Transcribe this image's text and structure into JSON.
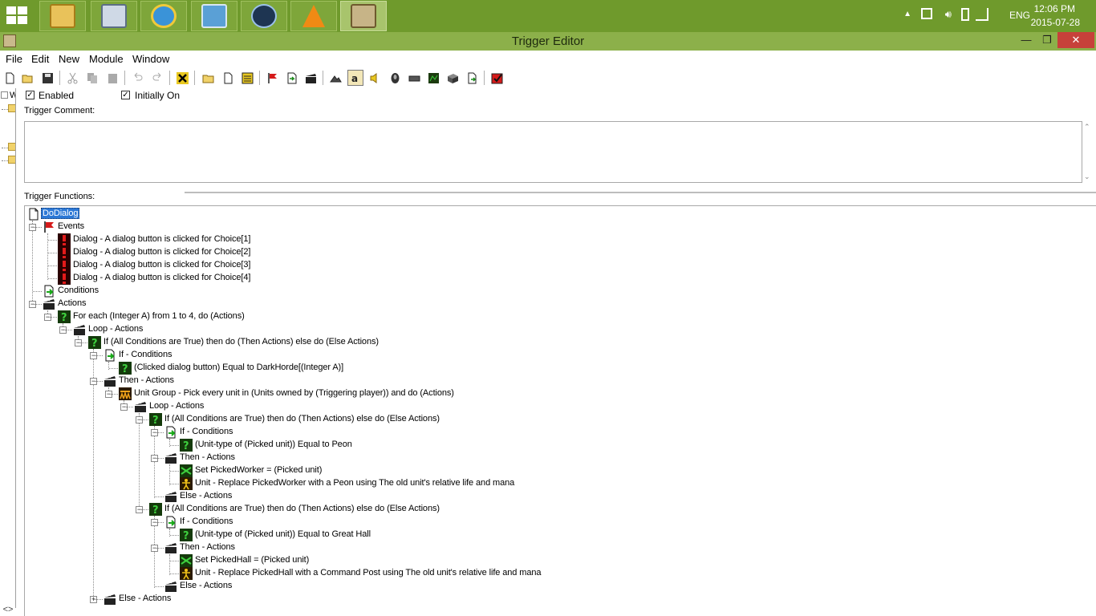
{
  "taskbar": {
    "apps": [
      "file-explorer",
      "system-monitor",
      "internet-explorer",
      "control-panel",
      "warcraft-launcher",
      "vlc",
      "world-editor"
    ],
    "tray": {
      "language": "ENG",
      "time": "12:06 PM",
      "date": "2015-07-28"
    }
  },
  "window": {
    "title": "Trigger Editor",
    "minimize": "—",
    "restore": "❐",
    "close": "✕"
  },
  "menu": [
    "File",
    "Edit",
    "New",
    "Module",
    "Window"
  ],
  "left_tree": {
    "label": "W"
  },
  "trigger": {
    "enabled_label": "Enabled",
    "enabled": true,
    "initially_on_label": "Initially On",
    "initially_on": true,
    "comment_label": "Trigger Comment:",
    "comment_value": "",
    "functions_label": "Trigger Functions:"
  },
  "tree": [
    {
      "id": "n0",
      "text": "DoDialog",
      "icon": "trigger-page",
      "selected": true
    },
    {
      "id": "n1",
      "text": "Events",
      "icon": "events-flag"
    },
    {
      "id": "n2",
      "text": "Dialog - A dialog button is clicked for Choice[1]",
      "icon": "event-alert"
    },
    {
      "id": "n3",
      "text": "Dialog - A dialog button is clicked for Choice[2]",
      "icon": "event-alert"
    },
    {
      "id": "n4",
      "text": "Dialog - A dialog button is clicked for Choice[3]",
      "icon": "event-alert"
    },
    {
      "id": "n5",
      "text": "Dialog - A dialog button is clicked for Choice[4]",
      "icon": "event-alert"
    },
    {
      "id": "n6",
      "text": "Conditions",
      "icon": "conditions"
    },
    {
      "id": "n7",
      "text": "Actions",
      "icon": "actions-clapper"
    },
    {
      "id": "n8",
      "text": "For each (Integer A) from 1 to 4, do (Actions)",
      "icon": "question-green"
    },
    {
      "id": "n9",
      "text": "Loop - Actions",
      "icon": "actions-clapper"
    },
    {
      "id": "n10",
      "text": "If (All Conditions are True) then do (Then Actions) else do (Else Actions)",
      "icon": "question-green"
    },
    {
      "id": "n11",
      "text": "If - Conditions",
      "icon": "conditions"
    },
    {
      "id": "n12",
      "text": "(Clicked dialog button) Equal to DarkHorde[(Integer A)]",
      "icon": "question-green"
    },
    {
      "id": "n13",
      "text": "Then - Actions",
      "icon": "actions-clapper"
    },
    {
      "id": "n14",
      "text": "Unit Group - Pick every unit in (Units owned by (Triggering player)) and do (Actions)",
      "icon": "unit-group"
    },
    {
      "id": "n15",
      "text": "Loop - Actions",
      "icon": "actions-clapper"
    },
    {
      "id": "n16",
      "text": "If (All Conditions are True) then do (Then Actions) else do (Else Actions)",
      "icon": "question-green"
    },
    {
      "id": "n17",
      "text": "If - Conditions",
      "icon": "conditions"
    },
    {
      "id": "n18",
      "text": "(Unit-type of (Picked unit)) Equal to Peon",
      "icon": "question-green"
    },
    {
      "id": "n19",
      "text": "Then - Actions",
      "icon": "actions-clapper"
    },
    {
      "id": "n20",
      "text": "Set PickedWorker = (Picked unit)",
      "icon": "set-variable"
    },
    {
      "id": "n21",
      "text": "Unit - Replace PickedWorker with a Peon using The old unit's relative life and mana",
      "icon": "unit"
    },
    {
      "id": "n22",
      "text": "Else - Actions",
      "icon": "actions-clapper"
    },
    {
      "id": "n23",
      "text": "If (All Conditions are True) then do (Then Actions) else do (Else Actions)",
      "icon": "question-green"
    },
    {
      "id": "n24",
      "text": "If - Conditions",
      "icon": "conditions"
    },
    {
      "id": "n25",
      "text": "(Unit-type of (Picked unit)) Equal to Great Hall",
      "icon": "question-green"
    },
    {
      "id": "n26",
      "text": "Then - Actions",
      "icon": "actions-clapper"
    },
    {
      "id": "n27",
      "text": "Set PickedHall = (Picked unit)",
      "icon": "set-variable"
    },
    {
      "id": "n28",
      "text": "Unit - Replace PickedHall with a Command Post using The old unit's relative life and mana",
      "icon": "unit"
    },
    {
      "id": "n29",
      "text": "Else - Actions",
      "icon": "actions-clapper"
    },
    {
      "id": "n30",
      "text": "Else - Actions",
      "icon": "actions-clapper"
    }
  ],
  "colors": {
    "taskbar": "#6f9a2c",
    "titlebar": "#8cb04a",
    "selection": "#2c78d6",
    "close": "#c7413a"
  }
}
